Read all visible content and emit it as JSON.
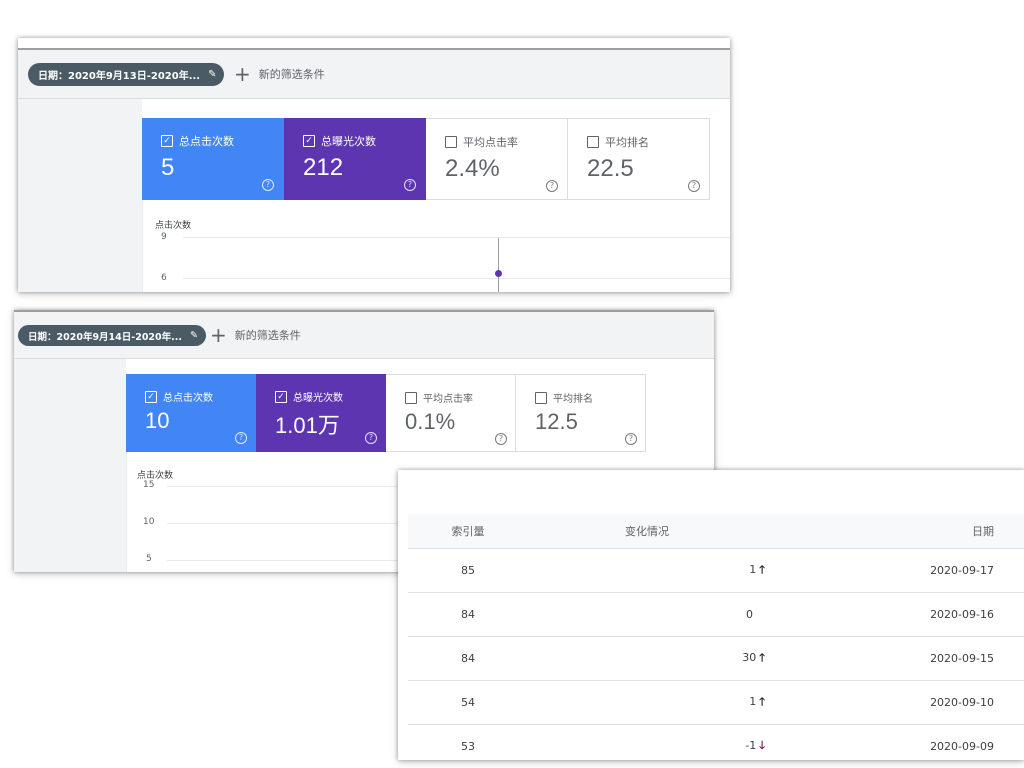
{
  "panel1": {
    "date_chip": "日期：2020年9月13日-2020年...",
    "new_filter": "新的筛选条件",
    "cards": [
      {
        "label": "总点击次数",
        "value": "5",
        "checked": true
      },
      {
        "label": "总曝光次数",
        "value": "212",
        "checked": true
      },
      {
        "label": "平均点击率",
        "value": "2.4%",
        "checked": false
      },
      {
        "label": "平均排名",
        "value": "22.5",
        "checked": false
      }
    ],
    "chart": {
      "ylabel": "点击次数",
      "ticks": [
        "9",
        "6"
      ]
    }
  },
  "panel2": {
    "date_chip": "日期：2020年9月14日-2020年...",
    "new_filter": "新的筛选条件",
    "cards": [
      {
        "label": "总点击次数",
        "value": "10",
        "checked": true
      },
      {
        "label": "总曝光次数",
        "value": "1.01万",
        "checked": true
      },
      {
        "label": "平均点击率",
        "value": "0.1%",
        "checked": false
      },
      {
        "label": "平均排名",
        "value": "12.5",
        "checked": false
      }
    ],
    "chart": {
      "ylabel": "点击次数",
      "ticks": [
        "15",
        "10",
        "5"
      ]
    }
  },
  "index_table": {
    "headers": [
      "索引量",
      "变化情况",
      "日期"
    ],
    "rows": [
      {
        "count": "85",
        "change": "1",
        "dir": "up",
        "date": "2020-09-17"
      },
      {
        "count": "84",
        "change": "0",
        "dir": "none",
        "date": "2020-09-16"
      },
      {
        "count": "84",
        "change": "30",
        "dir": "up",
        "date": "2020-09-15"
      },
      {
        "count": "54",
        "change": "1",
        "dir": "up",
        "date": "2020-09-10"
      },
      {
        "count": "53",
        "change": "-1",
        "dir": "down",
        "date": "2020-09-09"
      }
    ]
  },
  "icons": {
    "pencil": "pencil-icon",
    "plus": "plus-icon",
    "help": "help-circle-icon",
    "checkbox": "checkbox-icon",
    "arrow_up": "arrow-up-icon",
    "arrow_down": "arrow-down-icon"
  },
  "colors": {
    "clicks": "#4285f4",
    "impressions": "#5e35b1",
    "chip": "#4a5b66",
    "down_arrow": "#880e4f"
  }
}
